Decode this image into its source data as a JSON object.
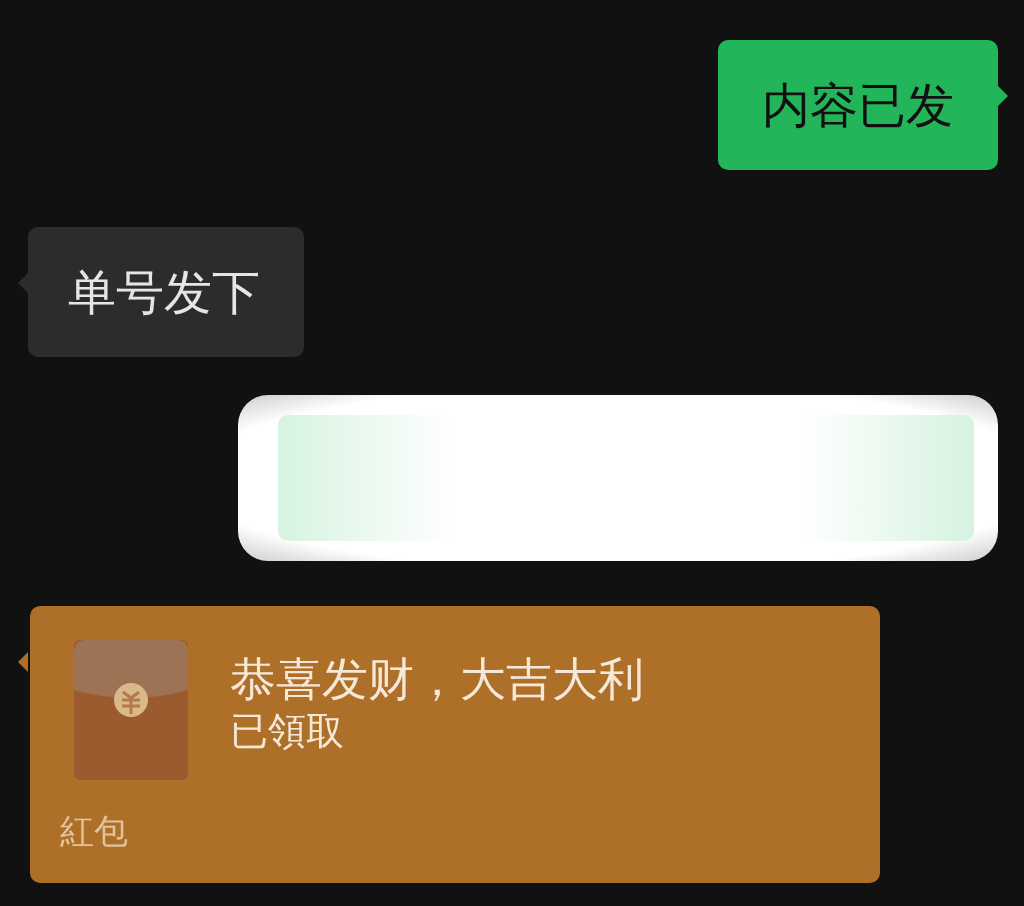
{
  "messages": [
    {
      "kind": "text",
      "outgoing": true,
      "text": "内容已发"
    },
    {
      "kind": "text",
      "outgoing": false,
      "text": "单号发下"
    },
    {
      "kind": "redacted",
      "outgoing": true
    },
    {
      "kind": "red_packet",
      "outgoing": false,
      "greeting": "恭喜发财，大吉大利",
      "status": "已領取",
      "label": "紅包"
    }
  ]
}
